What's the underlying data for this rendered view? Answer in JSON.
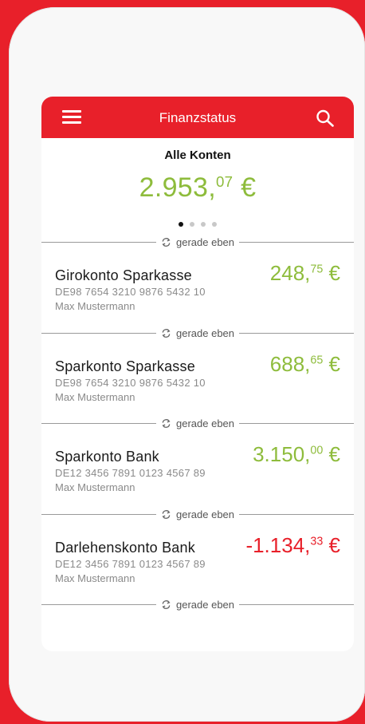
{
  "header": {
    "title": "Finanzstatus"
  },
  "summary": {
    "label": "Alle Konten",
    "amount_main": "2.953,",
    "amount_cents": "07",
    "currency": "€",
    "color": "#8ebc3c",
    "pager_count": 4,
    "pager_active": 1
  },
  "sync_label": "gerade eben",
  "accounts": [
    {
      "name": "Girokonto Sparkasse",
      "iban": "DE98 7654 3210 9876 5432 10",
      "owner": "Max Mustermann",
      "amount_main": "248,",
      "amount_cents": "75",
      "currency": "€",
      "color": "#8ebc3c"
    },
    {
      "name": "Sparkonto Sparkasse",
      "iban": "DE98 7654 3210 9876 5432 10",
      "owner": "Max Mustermann",
      "amount_main": "688,",
      "amount_cents": "65",
      "currency": "€",
      "color": "#8ebc3c"
    },
    {
      "name": "Sparkonto Bank",
      "iban": "DE12 3456 7891 0123 4567 89",
      "owner": "Max Mustermann",
      "amount_main": "3.150,",
      "amount_cents": "00",
      "currency": "€",
      "color": "#8ebc3c"
    },
    {
      "name": "Darlehenskonto Bank",
      "iban": "DE12 3456 7891 0123 4567 89",
      "owner": "Max Mustermann",
      "amount_main": "-1.134,",
      "amount_cents": "33",
      "currency": "€",
      "color": "#e8202a"
    }
  ],
  "colors": {
    "brand": "#e8202a",
    "positive": "#8ebc3c",
    "negative": "#e8202a"
  },
  "icons": {
    "menu": "hamburger-icon",
    "search": "search-icon",
    "sync": "refresh-icon"
  }
}
